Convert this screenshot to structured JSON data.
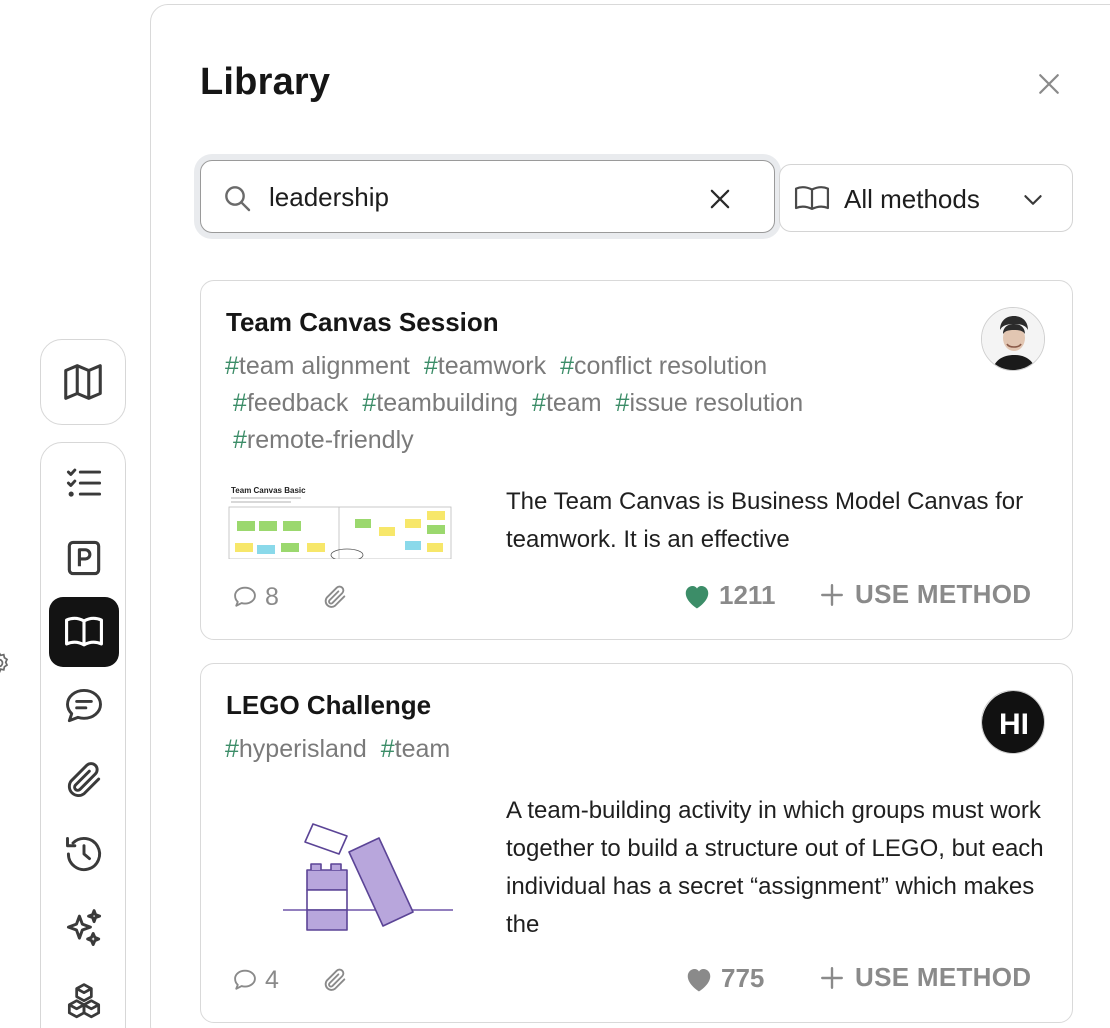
{
  "panel": {
    "title": "Library"
  },
  "search": {
    "value": "leadership"
  },
  "filter": {
    "label": "All methods"
  },
  "toolbar": {
    "items": [
      "map-icon",
      "checklist-icon",
      "parking-icon",
      "book-icon",
      "chat-icon",
      "paperclip-icon",
      "history-icon",
      "sparkles-icon",
      "blocks-icon"
    ],
    "active": "book-icon"
  },
  "cards": [
    {
      "title": "Team Canvas Session",
      "tags_line1": [
        "team alignment",
        "teamwork",
        "conflict resolution"
      ],
      "tags_line2": [
        "feedback",
        "teambuilding",
        "team",
        "issue resolution"
      ],
      "tags_line3": [
        "remote-friendly"
      ],
      "description": "The Team Canvas is Business Model Canvas for teamwork. It is an effective",
      "thumb_title": "Team Canvas Basic",
      "comments": "8",
      "likes": "1211",
      "liked": true,
      "use_label": "USE METHOD"
    },
    {
      "title": "LEGO Challenge",
      "tags_line1": [
        "hyperisland",
        "team"
      ],
      "description": "A team-building activity in which groups must work together to build a structure out of LEGO, but each individual has a secret “assignment” which makes the",
      "avatar_text": "HI",
      "comments": "4",
      "likes": "775",
      "liked": false,
      "use_label": "USE METHOD"
    }
  ],
  "colors": {
    "tag_hash": "#3c8d68",
    "liked_heart": "#3c8d68",
    "active_tool_bg": "#131313",
    "muted_text": "#8a8a8a"
  }
}
